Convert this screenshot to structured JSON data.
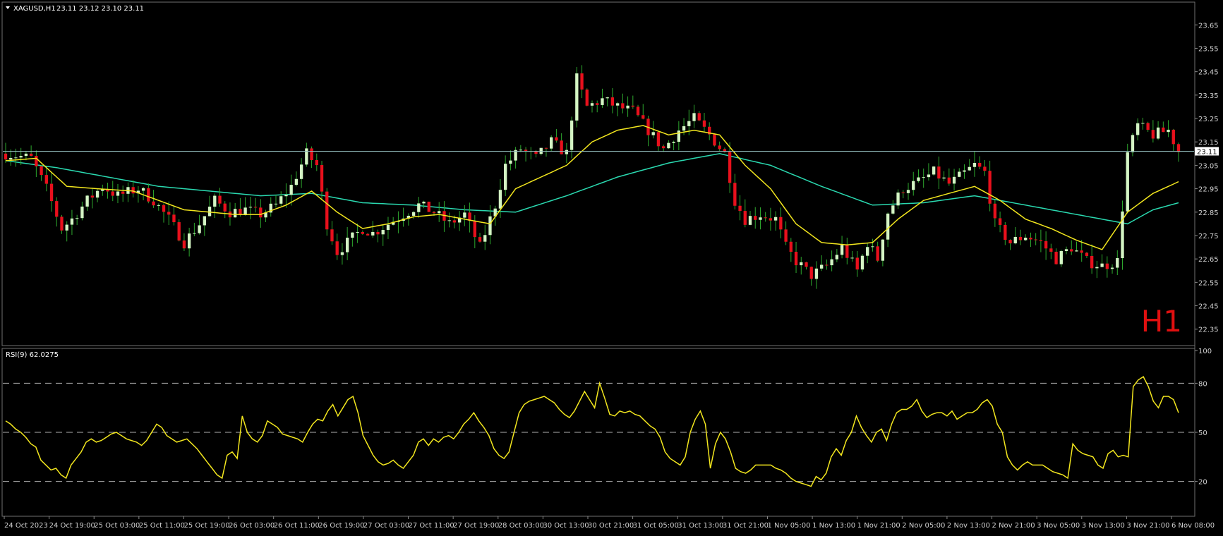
{
  "main_panel": {
    "symbol_label": "XAGUSD,H1",
    "ohlc_label": "23.11 23.12 23.10 23.11",
    "timeframe_watermark": "H1",
    "current_price_label": "23.11"
  },
  "rsi_panel": {
    "label": "RSI(9) 62.0275"
  },
  "colors": {
    "background": "#000000",
    "bull_candle": "#d4f5c4",
    "bear_candle": "#e8101c",
    "wick": "#2ea82e",
    "fast_ma": "#f2e61e",
    "slow_ma": "#2ad9b0",
    "rsi_line": "#f2e61e",
    "price_line": "#8fb8b8",
    "watermark": "#e01010",
    "axis_text": "#d0d0d0"
  },
  "chart_data": [
    {
      "type": "candlestick",
      "title": "XAGUSD,H1",
      "y_ticks": [
        23.65,
        23.55,
        23.45,
        23.35,
        23.25,
        23.15,
        23.05,
        22.95,
        22.85,
        22.75,
        22.65,
        22.55,
        22.45,
        22.35
      ],
      "ylim": [
        22.31,
        23.69
      ],
      "current_price": 23.11,
      "x_labels": [
        "24 Oct 2023",
        "24 Oct 19:00",
        "25 Oct 03:00",
        "25 Oct 11:00",
        "25 Oct 19:00",
        "26 Oct 03:00",
        "26 Oct 11:00",
        "26 Oct 19:00",
        "27 Oct 03:00",
        "27 Oct 11:00",
        "27 Oct 19:00",
        "28 Oct 03:00",
        "30 Oct 13:00",
        "30 Oct 21:00",
        "31 Oct 05:00",
        "31 Oct 13:00",
        "31 Oct 21:00",
        "1 Nov 05:00",
        "1 Nov 13:00",
        "1 Nov 21:00",
        "2 Nov 05:00",
        "2 Nov 13:00",
        "2 Nov 21:00",
        "3 Nov 05:00",
        "3 Nov 13:00",
        "3 Nov 21:00",
        "6 Nov 08:00"
      ],
      "price_path": [
        [
          0,
          23.1
        ],
        [
          5,
          23.08
        ],
        [
          8,
          22.95
        ],
        [
          11,
          22.78
        ],
        [
          13,
          22.82
        ],
        [
          16,
          22.9
        ],
        [
          19,
          22.96
        ],
        [
          22,
          22.92
        ],
        [
          26,
          22.95
        ],
        [
          29,
          22.9
        ],
        [
          32,
          22.82
        ],
        [
          35,
          22.72
        ],
        [
          38,
          22.8
        ],
        [
          41,
          22.9
        ],
        [
          44,
          22.85
        ],
        [
          47,
          22.86
        ],
        [
          50,
          22.84
        ],
        [
          53,
          22.88
        ],
        [
          56,
          22.96
        ],
        [
          59,
          23.1
        ],
        [
          61,
          23.05
        ],
        [
          63,
          22.8
        ],
        [
          65,
          22.68
        ],
        [
          67,
          22.72
        ],
        [
          70,
          22.78
        ],
        [
          72,
          22.76
        ],
        [
          75,
          22.8
        ],
        [
          78,
          22.84
        ],
        [
          81,
          22.88
        ],
        [
          84,
          22.85
        ],
        [
          87,
          22.8
        ],
        [
          90,
          22.84
        ],
        [
          93,
          22.7
        ],
        [
          96,
          22.88
        ],
        [
          98,
          23.05
        ],
        [
          101,
          23.12
        ],
        [
          104,
          23.08
        ],
        [
          107,
          23.15
        ],
        [
          110,
          23.1
        ],
        [
          112,
          23.42
        ],
        [
          114,
          23.3
        ],
        [
          117,
          23.33
        ],
        [
          120,
          23.3
        ],
        [
          123,
          23.28
        ],
        [
          126,
          23.2
        ],
        [
          129,
          23.12
        ],
        [
          132,
          23.2
        ],
        [
          135,
          23.25
        ],
        [
          138,
          23.18
        ],
        [
          141,
          23.1
        ],
        [
          143,
          22.9
        ],
        [
          145,
          22.82
        ],
        [
          148,
          22.84
        ],
        [
          151,
          22.82
        ],
        [
          153,
          22.7
        ],
        [
          155,
          22.64
        ],
        [
          158,
          22.58
        ],
        [
          161,
          22.62
        ],
        [
          164,
          22.7
        ],
        [
          167,
          22.6
        ],
        [
          169,
          22.72
        ],
        [
          171,
          22.65
        ],
        [
          173,
          22.85
        ],
        [
          176,
          22.95
        ],
        [
          179,
          22.98
        ],
        [
          182,
          23.02
        ],
        [
          185,
          22.97
        ],
        [
          187,
          23.0
        ],
        [
          190,
          23.05
        ],
        [
          192,
          23.02
        ],
        [
          194,
          22.8
        ],
        [
          197,
          22.72
        ],
        [
          200,
          22.75
        ],
        [
          203,
          22.72
        ],
        [
          206,
          22.65
        ],
        [
          209,
          22.7
        ],
        [
          212,
          22.64
        ],
        [
          215,
          22.62
        ],
        [
          218,
          22.64
        ],
        [
          220,
          23.1
        ],
        [
          222,
          23.22
        ],
        [
          225,
          23.18
        ],
        [
          228,
          23.2
        ],
        [
          230,
          23.11
        ]
      ],
      "series": [
        {
          "name": "fast_ma",
          "points": [
            [
              0,
              23.07
            ],
            [
              6,
              23.08
            ],
            [
              12,
              22.96
            ],
            [
              18,
              22.95
            ],
            [
              25,
              22.94
            ],
            [
              30,
              22.9
            ],
            [
              35,
              22.86
            ],
            [
              40,
              22.85
            ],
            [
              45,
              22.84
            ],
            [
              50,
              22.84
            ],
            [
              55,
              22.88
            ],
            [
              60,
              22.94
            ],
            [
              65,
              22.85
            ],
            [
              70,
              22.78
            ],
            [
              75,
              22.8
            ],
            [
              80,
              22.83
            ],
            [
              85,
              22.84
            ],
            [
              90,
              22.82
            ],
            [
              95,
              22.8
            ],
            [
              100,
              22.95
            ],
            [
              105,
              23.0
            ],
            [
              110,
              23.05
            ],
            [
              115,
              23.15
            ],
            [
              120,
              23.2
            ],
            [
              125,
              23.22
            ],
            [
              130,
              23.18
            ],
            [
              135,
              23.2
            ],
            [
              140,
              23.18
            ],
            [
              145,
              23.05
            ],
            [
              150,
              22.95
            ],
            [
              155,
              22.8
            ],
            [
              160,
              22.72
            ],
            [
              165,
              22.71
            ],
            [
              170,
              22.72
            ],
            [
              175,
              22.82
            ],
            [
              180,
              22.9
            ],
            [
              185,
              22.93
            ],
            [
              190,
              22.96
            ],
            [
              195,
              22.9
            ],
            [
              200,
              22.82
            ],
            [
              205,
              22.78
            ],
            [
              210,
              22.73
            ],
            [
              215,
              22.69
            ],
            [
              220,
              22.85
            ],
            [
              225,
              22.93
            ],
            [
              230,
              22.98
            ]
          ]
        },
        {
          "name": "slow_ma",
          "points": [
            [
              0,
              23.07
            ],
            [
              10,
              23.04
            ],
            [
              20,
              23.0
            ],
            [
              30,
              22.96
            ],
            [
              40,
              22.94
            ],
            [
              50,
              22.92
            ],
            [
              60,
              22.93
            ],
            [
              70,
              22.89
            ],
            [
              80,
              22.88
            ],
            [
              90,
              22.86
            ],
            [
              100,
              22.85
            ],
            [
              110,
              22.92
            ],
            [
              120,
              23.0
            ],
            [
              130,
              23.06
            ],
            [
              140,
              23.1
            ],
            [
              150,
              23.05
            ],
            [
              160,
              22.96
            ],
            [
              170,
              22.88
            ],
            [
              180,
              22.89
            ],
            [
              190,
              22.92
            ],
            [
              200,
              22.88
            ],
            [
              210,
              22.84
            ],
            [
              220,
              22.8
            ],
            [
              225,
              22.86
            ],
            [
              230,
              22.89
            ]
          ]
        }
      ]
    },
    {
      "type": "line",
      "title": "RSI(9) 62.0275",
      "ylim": [
        0,
        100
      ],
      "y_ticks": [
        100,
        80,
        50,
        20
      ],
      "levels": [
        80,
        50,
        20
      ],
      "values": [
        57,
        55,
        52,
        50,
        47,
        43,
        41,
        33,
        30,
        27,
        28,
        24,
        22,
        30,
        34,
        38,
        44,
        46,
        44,
        45,
        47,
        49,
        50,
        48,
        46,
        45,
        44,
        42,
        45,
        50,
        55,
        53,
        48,
        46,
        44,
        45,
        46,
        43,
        40,
        36,
        32,
        28,
        24,
        22,
        36,
        38,
        34,
        60,
        50,
        46,
        44,
        48,
        57,
        55,
        53,
        49,
        48,
        47,
        46,
        44,
        50,
        55,
        58,
        57,
        63,
        67,
        60,
        65,
        70,
        72,
        62,
        48,
        42,
        36,
        32,
        30,
        31,
        33,
        30,
        28,
        32,
        36,
        44,
        46,
        42,
        46,
        44,
        47,
        48,
        46,
        50,
        55,
        58,
        62,
        57,
        53,
        48,
        40,
        36,
        34,
        38,
        50,
        62,
        67,
        69,
        70,
        71,
        72,
        70,
        68,
        64,
        61,
        59,
        63,
        69,
        75,
        70,
        65,
        80,
        71,
        61,
        60,
        63,
        62,
        63,
        61,
        60,
        57,
        54,
        52,
        47,
        38,
        34,
        32,
        30,
        35,
        50,
        58,
        63,
        55,
        28,
        43,
        50,
        46,
        38,
        28,
        26,
        25,
        27,
        30,
        30,
        30,
        30,
        28,
        27,
        25,
        22,
        20,
        19,
        18,
        17,
        23,
        21,
        25,
        35,
        40,
        36,
        45,
        50,
        60,
        53,
        48,
        44,
        50,
        52,
        45,
        55,
        62,
        64,
        64,
        66,
        70,
        63,
        59,
        61,
        62,
        62,
        60,
        63,
        58,
        60,
        62,
        62,
        64,
        68,
        70,
        66,
        55,
        50,
        35,
        30,
        27,
        30,
        32,
        30,
        30,
        30,
        28,
        26,
        25,
        24,
        22,
        43,
        39,
        37,
        36,
        35,
        30,
        28,
        37,
        39,
        35,
        36,
        35,
        78,
        82,
        84,
        78,
        69,
        65,
        72,
        72,
        70,
        62
      ]
    }
  ]
}
